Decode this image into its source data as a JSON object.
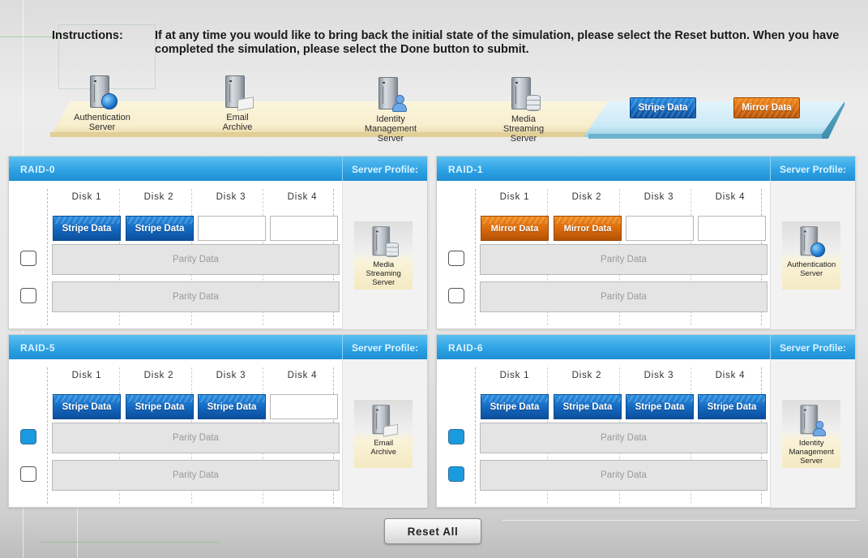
{
  "instructions": {
    "label": "Instructions:",
    "text": "If at any time you would like to bring back the initial state of the simulation, please select the Reset button. When you have completed the simulation, please select the Done button to submit."
  },
  "server_shelf": [
    {
      "name": "authentication-server",
      "icon": "server-globe-icon",
      "lines": [
        "Authentication",
        "Server"
      ]
    },
    {
      "name": "email-archive",
      "icon": "server-mail-icon",
      "lines": [
        "Email",
        "Archive"
      ]
    },
    {
      "name": "identity-management-server",
      "icon": "server-user-icon",
      "lines": [
        "Identity",
        "Management",
        "Server"
      ]
    },
    {
      "name": "media-streaming-server",
      "icon": "server-database-icon",
      "lines": [
        "Media",
        "Streaming",
        "Server"
      ]
    }
  ],
  "draggables": {
    "stripe": "Stripe Data",
    "mirror": "Mirror Data"
  },
  "colors": {
    "stripe": "#1467be",
    "mirror": "#d8690c",
    "header": "#2ea2e4",
    "checkbox_on": "#1a9be0"
  },
  "panels": [
    {
      "title": "RAID-0",
      "profile_label": "Server Profile:",
      "disks": [
        "Disk 1",
        "Disk 2",
        "Disk 3",
        "Disk 4"
      ],
      "slots": [
        {
          "type": "stripe",
          "label": "Stripe Data"
        },
        {
          "type": "stripe",
          "label": "Stripe Data"
        },
        {
          "type": "empty",
          "label": ""
        },
        {
          "type": "empty",
          "label": ""
        }
      ],
      "parity": [
        {
          "label": "Parity Data",
          "checked": false
        },
        {
          "label": "Parity Data",
          "checked": false
        }
      ],
      "profile": {
        "icon": "server-database-icon",
        "lines": [
          "Media",
          "Streaming",
          "Server"
        ]
      }
    },
    {
      "title": "RAID-1",
      "profile_label": "Server Profile:",
      "disks": [
        "Disk 1",
        "Disk 2",
        "Disk 3",
        "Disk 4"
      ],
      "slots": [
        {
          "type": "mirror",
          "label": "Mirror Data"
        },
        {
          "type": "mirror",
          "label": "Mirror Data"
        },
        {
          "type": "empty",
          "label": ""
        },
        {
          "type": "empty",
          "label": ""
        }
      ],
      "parity": [
        {
          "label": "Parity Data",
          "checked": false
        },
        {
          "label": "Parity Data",
          "checked": false
        }
      ],
      "profile": {
        "icon": "server-globe-icon",
        "lines": [
          "Authentication",
          "Server"
        ]
      }
    },
    {
      "title": "RAID-5",
      "profile_label": "Server Profile:",
      "disks": [
        "Disk 1",
        "Disk 2",
        "Disk 3",
        "Disk 4"
      ],
      "slots": [
        {
          "type": "stripe",
          "label": "Stripe Data"
        },
        {
          "type": "stripe",
          "label": "Stripe Data"
        },
        {
          "type": "stripe",
          "label": "Stripe Data"
        },
        {
          "type": "empty",
          "label": ""
        }
      ],
      "parity": [
        {
          "label": "Parity Data",
          "checked": true
        },
        {
          "label": "Parity Data",
          "checked": false
        }
      ],
      "profile": {
        "icon": "server-mail-icon",
        "lines": [
          "Email",
          "Archive"
        ]
      }
    },
    {
      "title": "RAID-6",
      "profile_label": "Server Profile:",
      "disks": [
        "Disk 1",
        "Disk 2",
        "Disk 3",
        "Disk 4"
      ],
      "slots": [
        {
          "type": "stripe",
          "label": "Stripe Data"
        },
        {
          "type": "stripe",
          "label": "Stripe Data"
        },
        {
          "type": "stripe",
          "label": "Stripe Data"
        },
        {
          "type": "stripe",
          "label": "Stripe Data"
        }
      ],
      "parity": [
        {
          "label": "Parity Data",
          "checked": true
        },
        {
          "label": "Parity Data",
          "checked": true
        }
      ],
      "profile": {
        "icon": "server-user-icon",
        "lines": [
          "Identity",
          "Management",
          "Server"
        ]
      }
    }
  ],
  "reset_button": "Reset All"
}
